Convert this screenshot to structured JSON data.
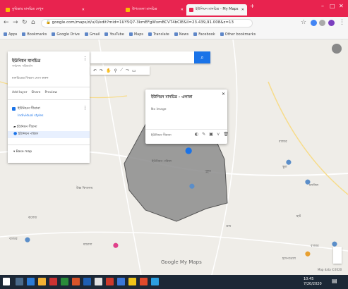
{
  "tabs": [
    {
      "title": "কুমিল্লার মানচিত্র দেখুন",
      "active": false
    },
    {
      "title": "উপজেলা মানচিত্র",
      "active": false
    },
    {
      "title": "ইউনিয়ন মানচিত্র - My Maps",
      "active": true
    }
  ],
  "address_bar": {
    "url": "google.com/maps/d/u/0/edit?mid=1UY5Q7-3kmEFgWxmBCVT4bCIE&ll=23.439,91.008&z=13"
  },
  "bookmarks": [
    "Apps",
    "Bookmarks",
    "Google Drive",
    "Gmail",
    "YouTube",
    "Maps",
    "Translate",
    "News",
    "Facebook",
    "Other bookmarks"
  ],
  "panel": {
    "map_title": "ইউনিয়ন মানচিত্র",
    "map_subtitle": "সর্বশেষ পরিবর্তন",
    "description": "মানচিত্রের বিবরণ যোগ করুন",
    "actions": [
      "Add layer",
      "Share",
      "Preview"
    ],
    "layer_name": "ইউনিয়ন সীমানা",
    "layer_style": "Individual styles",
    "items": [
      "ইউনিয়ন সীমানা",
      "ইউনিয়ন পরিষদ"
    ],
    "base_map": "Base map"
  },
  "info_window": {
    "title": "ইউনিয়ন মানচিত্র - এলাকা",
    "subtitle": "No image",
    "footer": "ইউনিয়ন সীমানা"
  },
  "map_labels": [
    "বাজার",
    "স্কুল",
    "মসজিদ",
    "হাট",
    "ইউনিয়ন পরিষদ",
    "উচ্চ বিদ্যালয়",
    "গ্রাম",
    "পুকুর",
    "বাজার",
    "মাদ্রাসা",
    "কলেজ",
    "বাজার",
    "হাসপাতাল",
    "গ্রাম"
  ],
  "footer": {
    "google_label": "Google My Maps",
    "map_data": "Map data ©2020"
  },
  "colors": {
    "tabbar": "#e8234f",
    "accent": "#1a73e8",
    "polygon_fill": "#8c8c8c",
    "taskbar": "#1c2836"
  },
  "taskbar": {
    "time": "10:45",
    "date": "7/20/2020"
  }
}
